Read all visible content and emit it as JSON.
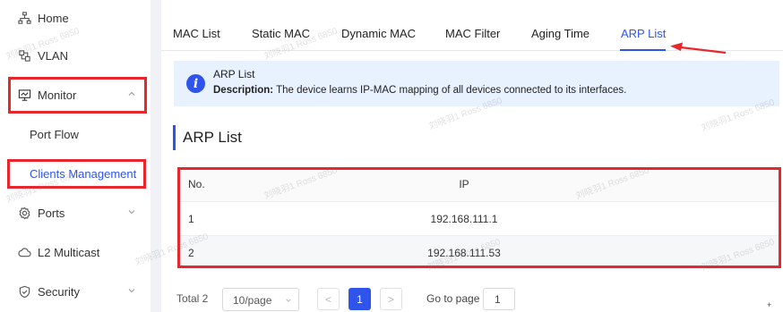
{
  "sidebar": {
    "items": [
      {
        "label": "Home",
        "icon": "network-icon"
      },
      {
        "label": "VLAN",
        "icon": "vlan-icon"
      },
      {
        "label": "Monitor",
        "icon": "monitor-icon"
      },
      {
        "label": "Port Flow"
      },
      {
        "label": "Clients Management"
      },
      {
        "label": "Ports",
        "icon": "gear-icon"
      },
      {
        "label": "L2 Multicast",
        "icon": "cloud-icon"
      },
      {
        "label": "Security",
        "icon": "shield-icon"
      }
    ]
  },
  "tabs": [
    "MAC List",
    "Static MAC",
    "Dynamic MAC",
    "MAC Filter",
    "Aging Time",
    "ARP List"
  ],
  "active_tab": "ARP List",
  "info": {
    "title": "ARP List",
    "description_label": "Description:",
    "description_text": "The device learns IP-MAC mapping of all devices connected to its interfaces."
  },
  "section": {
    "title": "ARP List"
  },
  "table": {
    "headers": [
      "No.",
      "IP"
    ],
    "rows": [
      {
        "no": "1",
        "ip": "192.168.111.1"
      },
      {
        "no": "2",
        "ip": "192.168.111.53"
      }
    ]
  },
  "pager": {
    "total": "Total 2",
    "page_size": "10/page",
    "prev": "<",
    "current_page": "1",
    "next": ">",
    "goto_label": "Go to page",
    "goto_value": "1"
  },
  "corner_mark": "+",
  "watermark": "刘晓羽1 Ross 6850",
  "colors": {
    "accent": "#2f54eb",
    "highlight": "#e8262d",
    "info_bg": "#e8f1fe"
  }
}
